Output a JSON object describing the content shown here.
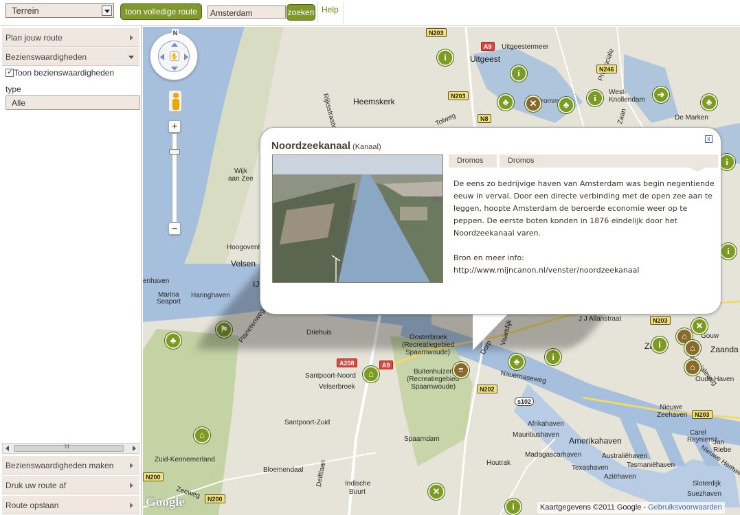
{
  "toolbar": {
    "map_type": "Terrein",
    "full_route_label": "toon volledige route",
    "search_value": "Amsterdam",
    "search_button": "zoeken",
    "help_label": "Help"
  },
  "sidebar": {
    "plan_route": "Plan jouw route",
    "sights": "Bezienswaardigheden",
    "show_sights": "Toon bezienswaardigheden",
    "type_label": "type",
    "type_value": "Alle",
    "scroll_label": "III",
    "make_sights": "Bezienswaardigheden maken",
    "print_route": "Druk uw route af",
    "save_route": "Route opslaan"
  },
  "map": {
    "north_label": "N",
    "google_logo": "Google",
    "copyright": "Kaartgegevens ©2011 Google - ",
    "terms_link": "Gebruiksvoorwaarden",
    "colors": {
      "water": "#a5bfdd",
      "land": "#e6e3d8",
      "green": "#c4d3a4",
      "dune": "#d7dcc3"
    },
    "places": {
      "uitgeestermeer": "Uitgeestermeer",
      "uitgeest": "Uitgeest",
      "heemskerk": "Heemskerk",
      "krommenie": "Krommenie",
      "west_knollendam": "West-",
      "west_knollendam2": "Knollendam",
      "de_marken": "De Marken",
      "rijksstraatweg": "Rijksstraatweg",
      "wijk_aan_zee": "Wijk",
      "wijk_aan_zee2": "aan Zee",
      "hoogovens": "Hoogovenha",
      "velsen": "Velsen",
      "ijmuiden": "IJ",
      "haven": "enhaven",
      "marina": "Marina",
      "marina2": "Seaport",
      "haringhaven": "Haringhaven",
      "planetenweg": "Planetenweg",
      "driehuis": "Driehuis",
      "oosterbroek": "Oosterbroek",
      "oosterbroek2": "(Recreatiegebied",
      "oosterbroek3": "Spaarnwoude)",
      "buitenhuizen": "Buitenhuizen",
      "buitenhuizen2": "(Recreatiegebied",
      "buitenhuizen3": "Spaarnwoude)",
      "santpoort_noord": "Santpoort-Noord",
      "velserbroek": "Velserbroek",
      "santpoort_zuid": "Santpoort-Zuid",
      "spaarndam": "Spaarndam",
      "zuid_kennemerland": "Zuid-Kennemerland",
      "bloemendaal": "Bloemendaal",
      "delftlaan": "Delftlaan",
      "indische_buurt": "Indische",
      "indische_buurt2": "Buurt",
      "zeeweg": "Zeeweg",
      "houtrak": "Houtrak",
      "nauernasevaart": "Nauernaseweg",
      "afrikahaven": "Afrikahaven",
      "mauritiushaven": "Mauritiushaven",
      "amerikahaven": "Amerikahaven",
      "madagascarhaven": "Madagascarhaven",
      "texashaven": "Texashaven",
      "australiehaven": "Australiëhaven",
      "tasmaniehaven": "Tasmaniëhaven",
      "aziehaven": "Aziëhaven",
      "jj_allanstraat": "J J Allanstraat",
      "zaandam": "Zaanda",
      "zaanstad": "Za",
      "gouw": "Gouw",
      "oude_haven": "Oude Haven",
      "provincialeweg": "Provincialeweg",
      "nieuwe_zeehaven": "Nieuwe",
      "nieuwe_zeehaven2": "Zeehaven",
      "carel": "Carel",
      "reyniers": "Reyniersz",
      "jan": "Jan",
      "riebe": "Riebe",
      "nieuwe_hemweg": "Nieuwe Hemweg",
      "suezhaven": "Suezhaven",
      "sloterdijk": "Sloterdijk",
      "provinciale": "Provinciale",
      "zaan": "Zaan",
      "tolweg": "Tolweg",
      "vaartdijk": "Vaartdijk",
      "dorp": "Dorp"
    },
    "roads": {
      "n203a": "N203",
      "a9a": "A9",
      "n246": "N246",
      "n203b": "N203",
      "n8": "N8",
      "a208": "A208",
      "a9b": "A9",
      "n202": "N202",
      "s102": "s102",
      "n203c": "N203",
      "n203d": "N203",
      "n200a": "N200",
      "n200b": "N200"
    }
  },
  "info_window": {
    "title": "Noordzeekanaal",
    "category": "(Kanaal)",
    "tab1": "Dromos",
    "tab2": "Dromos",
    "description": "De eens zo bedrijvige haven van Amsterdam was begin negentiende eeuw in verval. Door een directe verbinding met de open zee aan te leggen, hoopte Amsterdam de beroerde economie weer op te peppen. De eerste boten konden in 1876 eindelijk door het Noordzeekanaal varen.",
    "source_label": "Bron en meer info:",
    "source_url": "http://www.mijncanon.nl/venster/noordzeekanaal",
    "close_label": "x"
  }
}
